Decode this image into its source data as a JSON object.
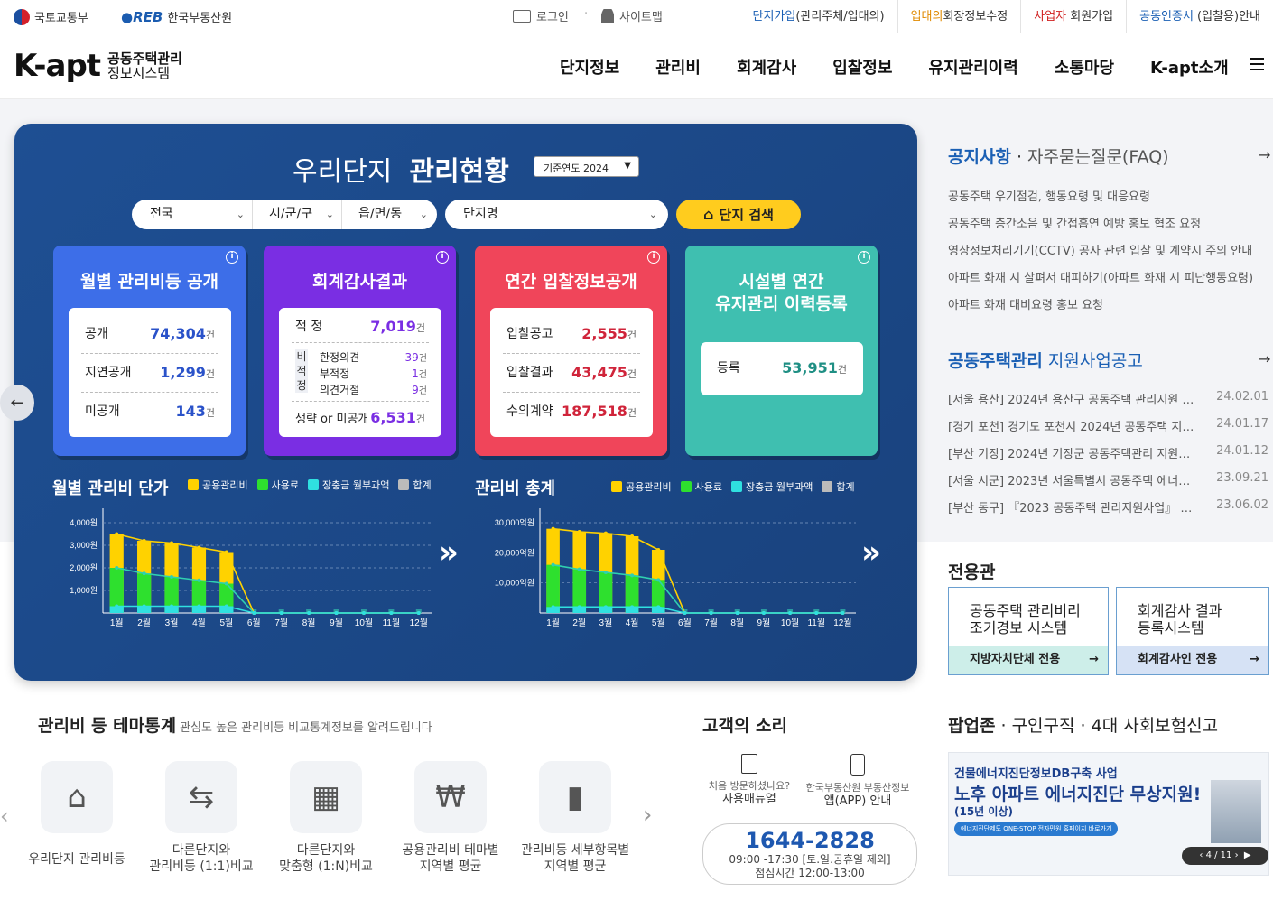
{
  "top": {
    "agency1": "국토교통부",
    "agency2": "한국부동산원",
    "login": "로그인",
    "sitemap": "사이트맵",
    "links": [
      {
        "hl": "단지가입",
        "rest": "(관리주체/입대의)",
        "color": "#1a5fb4"
      },
      {
        "hl": "입대의",
        "rest": "회장정보수정",
        "color": "#e08a00"
      },
      {
        "hl": "사업자",
        "rest": " 회원가입",
        "color": "#d02020"
      },
      {
        "hl": "공동인증서",
        "rest": " (입찰용)안내",
        "color": "#1a5fb4"
      }
    ]
  },
  "header": {
    "brand": "K-apt",
    "sub1": "공동주택관리",
    "sub2": "정보시스템",
    "menu": [
      "단지정보",
      "관리비",
      "회계감사",
      "입찰정보",
      "유지관리이력",
      "소통마당",
      "K-apt소개"
    ]
  },
  "panel": {
    "title_light": "우리단지",
    "title_bold": "관리현황",
    "year": "기준연도 2024",
    "selects": [
      "전국",
      "시/군/구",
      "읍/면/동"
    ],
    "danji": "단지명",
    "search_btn": "단지 검색",
    "card1": {
      "title": "월별 관리비등 공개",
      "rows": [
        {
          "k": "공개",
          "v": "74,304"
        },
        {
          "k": "지연공개",
          "v": "1,299"
        },
        {
          "k": "미공개",
          "v": "143"
        }
      ]
    },
    "card2": {
      "title": "회계감사결과",
      "top": {
        "k": "적 정",
        "v": "7,019"
      },
      "side": "비적정",
      "sub": [
        {
          "k": "한정의견",
          "v": "39"
        },
        {
          "k": "부적정",
          "v": "1"
        },
        {
          "k": "의견거절",
          "v": "9"
        }
      ],
      "bottom": {
        "k": "생략 or 미공개",
        "v": "6,531"
      }
    },
    "card3": {
      "title": "연간 입찰정보공개",
      "rows": [
        {
          "k": "입찰공고",
          "v": "2,555"
        },
        {
          "k": "입찰결과",
          "v": "43,475"
        },
        {
          "k": "수의계약",
          "v": "187,518"
        }
      ]
    },
    "card4": {
      "title1": "시설별 연간",
      "title2": "유지관리 이력등록",
      "row": {
        "k": "등록",
        "v": "53,951"
      }
    },
    "unit": "건"
  },
  "chart_data": [
    {
      "type": "bar",
      "title": "월별 관리비 단가",
      "categories": [
        "1월",
        "2월",
        "3월",
        "4월",
        "5월",
        "6월",
        "7월",
        "8월",
        "9월",
        "10월",
        "11월",
        "12월"
      ],
      "yticks": [
        "4,000원",
        "3,000원",
        "2,000원",
        "1,000원"
      ],
      "ylim": [
        0,
        4400
      ],
      "series": [
        {
          "name": "공용관리비",
          "color": "#ffd200",
          "values": [
            3500,
            3200,
            3100,
            2900,
            2700,
            0,
            0,
            0,
            0,
            0,
            0,
            0
          ]
        },
        {
          "name": "사용료",
          "color": "#2ee02e",
          "values": [
            2000,
            1750,
            1600,
            1450,
            1300,
            0,
            0,
            0,
            0,
            0,
            0,
            0
          ]
        },
        {
          "name": "장충금 월부과액",
          "color": "#2fe0e0",
          "values": [
            300,
            300,
            300,
            300,
            300,
            0,
            0,
            0,
            0,
            0,
            0,
            0
          ]
        },
        {
          "name": "합계",
          "color": "#bbbbbb",
          "values": []
        }
      ]
    },
    {
      "type": "bar",
      "title": "관리비 총계",
      "categories": [
        "1월",
        "2월",
        "3월",
        "4월",
        "5월",
        "6월",
        "7월",
        "8월",
        "9월",
        "10월",
        "11월",
        "12월"
      ],
      "yticks": [
        "30,000억원",
        "20,000억원",
        "10,000억원"
      ],
      "ylim": [
        0,
        33000
      ],
      "series": [
        {
          "name": "공용관리비",
          "color": "#ffd200",
          "values": [
            28000,
            27000,
            26500,
            25500,
            21000,
            0,
            0,
            0,
            0,
            0,
            0,
            0
          ]
        },
        {
          "name": "사용료",
          "color": "#2ee02e",
          "values": [
            16000,
            14500,
            13500,
            12500,
            11000,
            0,
            0,
            0,
            0,
            0,
            0,
            0
          ]
        },
        {
          "name": "장충금 월부과액",
          "color": "#2fe0e0",
          "values": [
            2000,
            2000,
            2000,
            2000,
            2000,
            0,
            0,
            0,
            0,
            0,
            0,
            0
          ]
        },
        {
          "name": "합계",
          "color": "#bbbbbb",
          "values": []
        }
      ]
    }
  ],
  "notice": {
    "tab1": "공지사항",
    "tab2": "자주묻는질문(FAQ)",
    "items": [
      "공동주택 우기점검, 행동요령 및 대응요령",
      "공동주택 층간소음 및 간접흡연 예방 홍보 협조 요청",
      "영상정보처리기기(CCTV) 공사 관련 입찰 및 계약시 주의 안내",
      "아파트 화재 시 살펴서 대피하기(아파트 화재 시 피난행동요령)",
      "아파트 화재 대비요령 홍보 요청"
    ]
  },
  "support": {
    "title1": "공동주택관리",
    "title2": " 지원사업공고",
    "items": [
      {
        "t": "[서울 용산] 2024년 용산구 공동주택 관리지원 …",
        "d": "24.02.01"
      },
      {
        "t": "[경기 포천] 경기도 포천시 2024년 공동주택 지…",
        "d": "24.01.17"
      },
      {
        "t": "[부산 기장] 2024년 기장군 공동주택관리 지원…",
        "d": "24.01.12"
      },
      {
        "t": "[서울 시군] 2023년 서울특별시 공동주택 에너…",
        "d": "23.09.21"
      },
      {
        "t": "[부산 동구] 『2023 공동주택 관리지원사업』 …",
        "d": "23.06.02"
      }
    ]
  },
  "dedicated": {
    "title": "전용관",
    "box1": {
      "t1": "공동주택 관리비리",
      "t2": "조기경보 시스템",
      "b": "지방자치단체 전용"
    },
    "box2": {
      "t1": "회계감사 결과",
      "t2": "등록시스템",
      "b": "회계감사인 전용"
    }
  },
  "theme": {
    "title": "관리비 등 테마통계",
    "desc": "관심도 높은 관리비등 비교통계정보를 알려드립니다",
    "items": [
      {
        "l1": "우리단지 관리비등",
        "l2": ""
      },
      {
        "l1": "다른단지와",
        "l2": "관리비등 (1:1)비교"
      },
      {
        "l1": "다른단지와",
        "l2": "맞춤형 (1:N)비교"
      },
      {
        "l1": "공용관리비 테마별",
        "l2": "지역별 평균"
      },
      {
        "l1": "관리비등 세부항목별",
        "l2": "지역별 평균"
      }
    ]
  },
  "voice": {
    "title": "고객의 소리",
    "i1a": "처음 방문하셨나요?",
    "i1b": "사용매뉴얼",
    "i2a": "한국부동산원 부동산정보",
    "i2b": "앱(APP) 안내",
    "phone": "1644-2828",
    "hours": "09:00 -17:30 [토.일.공휴일 제외]",
    "lunch": "점심시간 12:00-13:00"
  },
  "popup": {
    "title1": "팝업존",
    "title2": " · 구인구직 · 4대 사회보험신고",
    "l1": "건물에너지진단정보DB구축 사업",
    "l2": "노후 아파트 에너지진단 무상지원!",
    "l3": "(15년 이상)",
    "l4": "에너지진단제도 ONE-STOP 전자민원 홈페이지 바로가기",
    "page": "4 / 11"
  }
}
